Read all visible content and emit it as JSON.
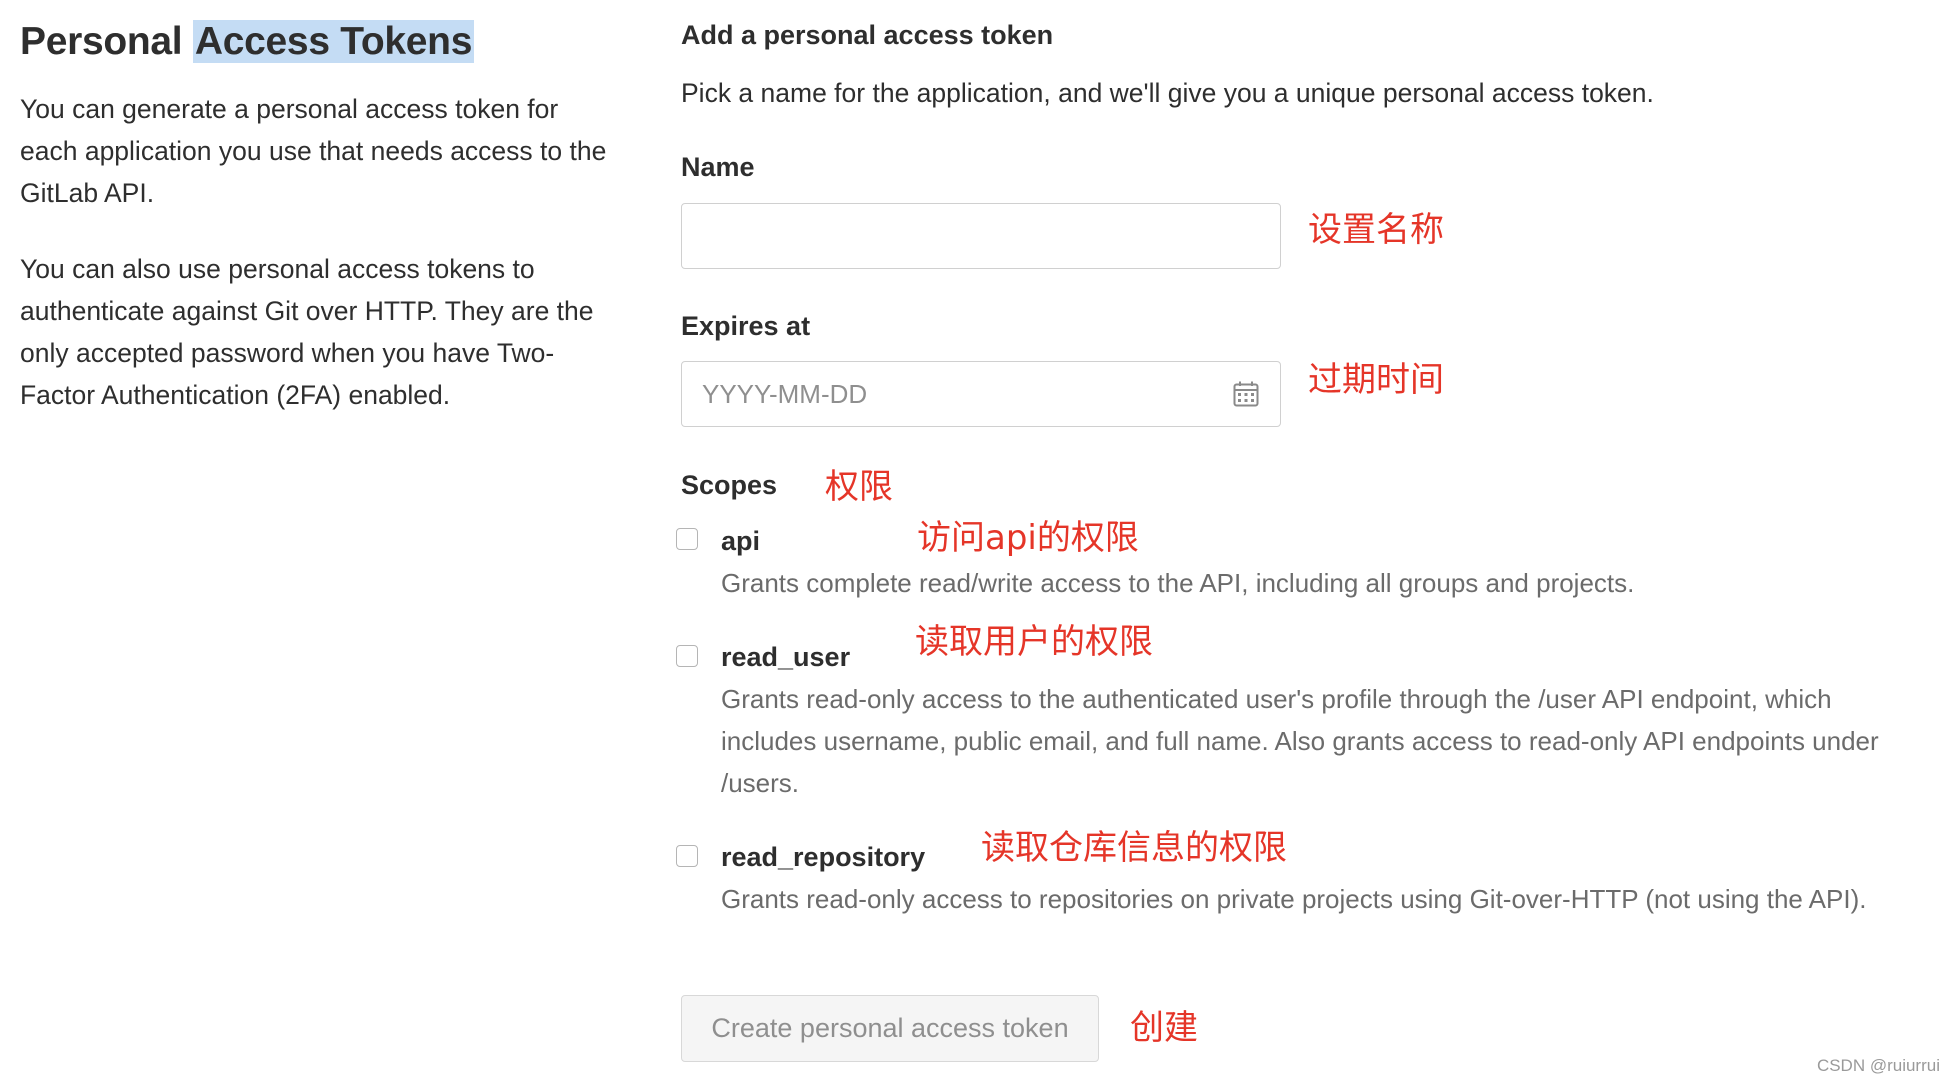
{
  "left": {
    "title_part1": "Personal ",
    "title_part2": "Access Tokens",
    "paragraph1": "You can generate a personal access token for each application you use that needs access to the GitLab API.",
    "paragraph2": "You can also use personal access tokens to authenticate against Git over HTTP. They are the only accepted password when you have Two-Factor Authentication (2FA) enabled."
  },
  "form": {
    "heading": "Add a personal access token",
    "description": "Pick a name for the application, and we'll give you a unique personal access token.",
    "name_label": "Name",
    "name_value": "",
    "expires_label": "Expires at",
    "expires_placeholder": "YYYY-MM-DD",
    "expires_icon": "calendar-icon",
    "scopes_label": "Scopes",
    "scopes": [
      {
        "name": "api",
        "description": "Grants complete read/write access to the API, including all groups and projects.",
        "checked": false
      },
      {
        "name": "read_user",
        "description": "Grants read-only access to the authenticated user's profile through the /user API endpoint, which includes username, public email, and full name. Also grants access to read-only API endpoints under /users.",
        "checked": false
      },
      {
        "name": "read_repository",
        "description": "Grants read-only access to repositories on private projects using Git-over-HTTP (not using the API).",
        "checked": false
      }
    ],
    "submit_label": "Create personal access token"
  },
  "annotations": {
    "name": "设置名称",
    "expires": "过期时间",
    "scopes": "权限",
    "api": "访问api的权限",
    "read_user": "读取用户的权限",
    "read_repository": "读取仓库信息的权限",
    "create": "创建",
    "color": "#e53528"
  },
  "highlight_color": "#c4dcf4",
  "watermark": "CSDN @ruiurrui"
}
